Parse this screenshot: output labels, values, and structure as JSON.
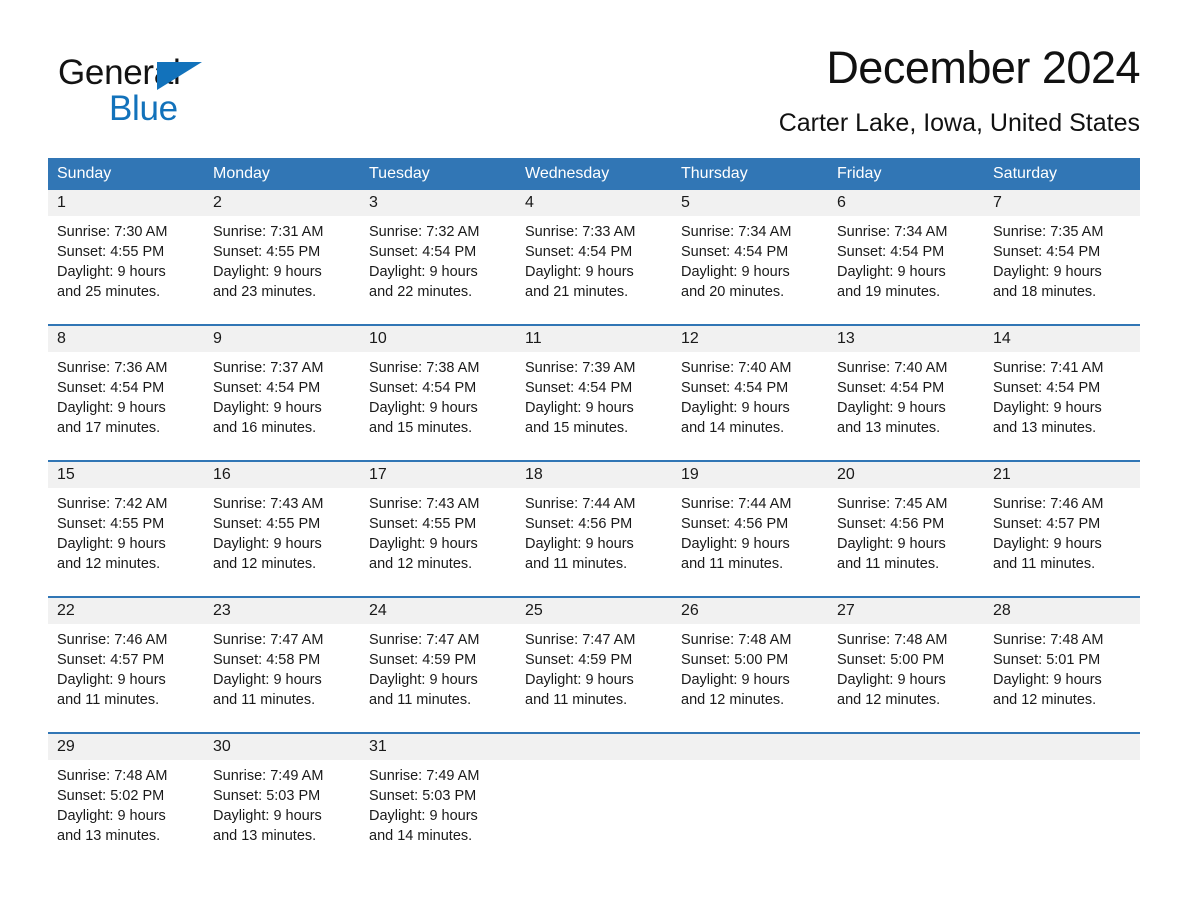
{
  "brand": {
    "name_part1": "General",
    "name_part2": "Blue",
    "triangle_icon": "blue-triangle-icon",
    "colors": {
      "brand_blue": "#1272bb",
      "header_blue": "#3176b5",
      "date_band_gray": "#f1f1f1",
      "text_black": "#1a1a1a"
    }
  },
  "header": {
    "title": "December 2024",
    "subtitle": "Carter Lake, Iowa, United States"
  },
  "calendar": {
    "weekdays": [
      "Sunday",
      "Monday",
      "Tuesday",
      "Wednesday",
      "Thursday",
      "Friday",
      "Saturday"
    ],
    "weeks": [
      {
        "days": [
          {
            "date": "1",
            "lines": [
              "Sunrise: 7:30 AM",
              "Sunset: 4:55 PM",
              "Daylight: 9 hours",
              "and 25 minutes."
            ]
          },
          {
            "date": "2",
            "lines": [
              "Sunrise: 7:31 AM",
              "Sunset: 4:55 PM",
              "Daylight: 9 hours",
              "and 23 minutes."
            ]
          },
          {
            "date": "3",
            "lines": [
              "Sunrise: 7:32 AM",
              "Sunset: 4:54 PM",
              "Daylight: 9 hours",
              "and 22 minutes."
            ]
          },
          {
            "date": "4",
            "lines": [
              "Sunrise: 7:33 AM",
              "Sunset: 4:54 PM",
              "Daylight: 9 hours",
              "and 21 minutes."
            ]
          },
          {
            "date": "5",
            "lines": [
              "Sunrise: 7:34 AM",
              "Sunset: 4:54 PM",
              "Daylight: 9 hours",
              "and 20 minutes."
            ]
          },
          {
            "date": "6",
            "lines": [
              "Sunrise: 7:34 AM",
              "Sunset: 4:54 PM",
              "Daylight: 9 hours",
              "and 19 minutes."
            ]
          },
          {
            "date": "7",
            "lines": [
              "Sunrise: 7:35 AM",
              "Sunset: 4:54 PM",
              "Daylight: 9 hours",
              "and 18 minutes."
            ]
          }
        ]
      },
      {
        "days": [
          {
            "date": "8",
            "lines": [
              "Sunrise: 7:36 AM",
              "Sunset: 4:54 PM",
              "Daylight: 9 hours",
              "and 17 minutes."
            ]
          },
          {
            "date": "9",
            "lines": [
              "Sunrise: 7:37 AM",
              "Sunset: 4:54 PM",
              "Daylight: 9 hours",
              "and 16 minutes."
            ]
          },
          {
            "date": "10",
            "lines": [
              "Sunrise: 7:38 AM",
              "Sunset: 4:54 PM",
              "Daylight: 9 hours",
              "and 15 minutes."
            ]
          },
          {
            "date": "11",
            "lines": [
              "Sunrise: 7:39 AM",
              "Sunset: 4:54 PM",
              "Daylight: 9 hours",
              "and 15 minutes."
            ]
          },
          {
            "date": "12",
            "lines": [
              "Sunrise: 7:40 AM",
              "Sunset: 4:54 PM",
              "Daylight: 9 hours",
              "and 14 minutes."
            ]
          },
          {
            "date": "13",
            "lines": [
              "Sunrise: 7:40 AM",
              "Sunset: 4:54 PM",
              "Daylight: 9 hours",
              "and 13 minutes."
            ]
          },
          {
            "date": "14",
            "lines": [
              "Sunrise: 7:41 AM",
              "Sunset: 4:54 PM",
              "Daylight: 9 hours",
              "and 13 minutes."
            ]
          }
        ]
      },
      {
        "days": [
          {
            "date": "15",
            "lines": [
              "Sunrise: 7:42 AM",
              "Sunset: 4:55 PM",
              "Daylight: 9 hours",
              "and 12 minutes."
            ]
          },
          {
            "date": "16",
            "lines": [
              "Sunrise: 7:43 AM",
              "Sunset: 4:55 PM",
              "Daylight: 9 hours",
              "and 12 minutes."
            ]
          },
          {
            "date": "17",
            "lines": [
              "Sunrise: 7:43 AM",
              "Sunset: 4:55 PM",
              "Daylight: 9 hours",
              "and 12 minutes."
            ]
          },
          {
            "date": "18",
            "lines": [
              "Sunrise: 7:44 AM",
              "Sunset: 4:56 PM",
              "Daylight: 9 hours",
              "and 11 minutes."
            ]
          },
          {
            "date": "19",
            "lines": [
              "Sunrise: 7:44 AM",
              "Sunset: 4:56 PM",
              "Daylight: 9 hours",
              "and 11 minutes."
            ]
          },
          {
            "date": "20",
            "lines": [
              "Sunrise: 7:45 AM",
              "Sunset: 4:56 PM",
              "Daylight: 9 hours",
              "and 11 minutes."
            ]
          },
          {
            "date": "21",
            "lines": [
              "Sunrise: 7:46 AM",
              "Sunset: 4:57 PM",
              "Daylight: 9 hours",
              "and 11 minutes."
            ]
          }
        ]
      },
      {
        "days": [
          {
            "date": "22",
            "lines": [
              "Sunrise: 7:46 AM",
              "Sunset: 4:57 PM",
              "Daylight: 9 hours",
              "and 11 minutes."
            ]
          },
          {
            "date": "23",
            "lines": [
              "Sunrise: 7:47 AM",
              "Sunset: 4:58 PM",
              "Daylight: 9 hours",
              "and 11 minutes."
            ]
          },
          {
            "date": "24",
            "lines": [
              "Sunrise: 7:47 AM",
              "Sunset: 4:59 PM",
              "Daylight: 9 hours",
              "and 11 minutes."
            ]
          },
          {
            "date": "25",
            "lines": [
              "Sunrise: 7:47 AM",
              "Sunset: 4:59 PM",
              "Daylight: 9 hours",
              "and 11 minutes."
            ]
          },
          {
            "date": "26",
            "lines": [
              "Sunrise: 7:48 AM",
              "Sunset: 5:00 PM",
              "Daylight: 9 hours",
              "and 12 minutes."
            ]
          },
          {
            "date": "27",
            "lines": [
              "Sunrise: 7:48 AM",
              "Sunset: 5:00 PM",
              "Daylight: 9 hours",
              "and 12 minutes."
            ]
          },
          {
            "date": "28",
            "lines": [
              "Sunrise: 7:48 AM",
              "Sunset: 5:01 PM",
              "Daylight: 9 hours",
              "and 12 minutes."
            ]
          }
        ]
      },
      {
        "days": [
          {
            "date": "29",
            "lines": [
              "Sunrise: 7:48 AM",
              "Sunset: 5:02 PM",
              "Daylight: 9 hours",
              "and 13 minutes."
            ]
          },
          {
            "date": "30",
            "lines": [
              "Sunrise: 7:49 AM",
              "Sunset: 5:03 PM",
              "Daylight: 9 hours",
              "and 13 minutes."
            ]
          },
          {
            "date": "31",
            "lines": [
              "Sunrise: 7:49 AM",
              "Sunset: 5:03 PM",
              "Daylight: 9 hours",
              "and 14 minutes."
            ]
          },
          {
            "date": "",
            "lines": []
          },
          {
            "date": "",
            "lines": []
          },
          {
            "date": "",
            "lines": []
          },
          {
            "date": "",
            "lines": []
          }
        ]
      }
    ]
  }
}
